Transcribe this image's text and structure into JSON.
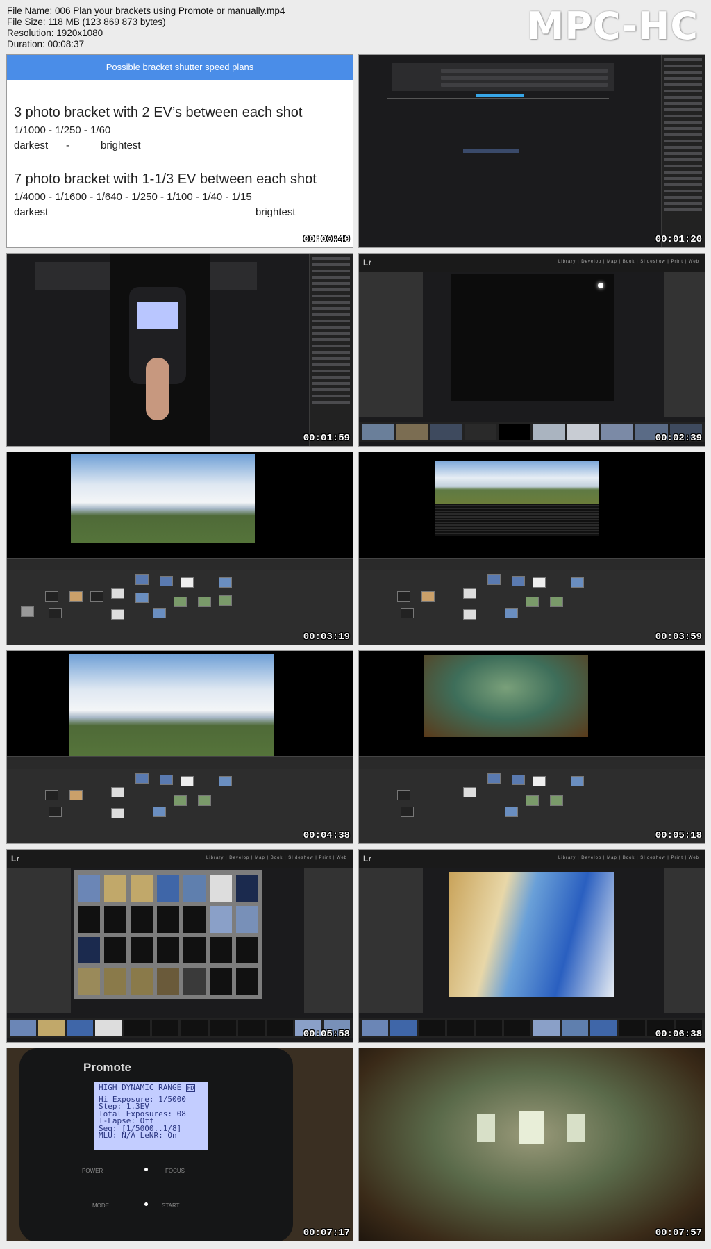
{
  "header": {
    "file_name": "File Name: 006 Plan your brackets using Promote or manually.mp4",
    "file_size": "File Size: 118 MB (123 869 873 bytes)",
    "resolution": "Resolution: 1920x1080",
    "duration": "Duration: 00:08:37"
  },
  "brand": "MPC-HC",
  "slide": {
    "title": "Possible bracket shutter speed plans",
    "h1": "3 photo bracket with 2 EV’s between each shot",
    "l1": "1/1000 - 1/250 - 1/60",
    "d1": "darkest",
    "sep1": "-",
    "b1": "brightest",
    "h2": "7 photo bracket with 1-1/3 EV between each shot",
    "l2": "1/4000 - 1/1600 - 1/640 - 1/250 - 1/100 - 1/40 - 1/15",
    "d2": "darkest",
    "b2": "brightest"
  },
  "lightroom": {
    "logo": "Lr",
    "modules": "Library | Develop | Map | Book | Slideshow | Print | Web"
  },
  "device": {
    "brand": "Promote",
    "line1": "HIGH DYNAMIC RANGE",
    "badge": "HD",
    "line2": "Hi Exposure: 1/5000",
    "line3": "Step: 1.3EV",
    "line4": "Total Exposures: 08",
    "line5": "T-Lapse: Off",
    "line6": "Seq: [1/5000..1/8]",
    "line7": "MLU: N/A   LeNR: On",
    "power": "POWER",
    "focus": "FOCUS",
    "mode": "MODE",
    "start": "START"
  },
  "thumbnails": [
    {
      "timestamp": "00:00:40"
    },
    {
      "timestamp": "00:01:20"
    },
    {
      "timestamp": "00:01:59"
    },
    {
      "timestamp": "00:02:39"
    },
    {
      "timestamp": "00:03:19"
    },
    {
      "timestamp": "00:03:59"
    },
    {
      "timestamp": "00:04:38"
    },
    {
      "timestamp": "00:05:18"
    },
    {
      "timestamp": "00:05:58"
    },
    {
      "timestamp": "00:06:38"
    },
    {
      "timestamp": "00:07:17"
    },
    {
      "timestamp": "00:07:57"
    }
  ]
}
